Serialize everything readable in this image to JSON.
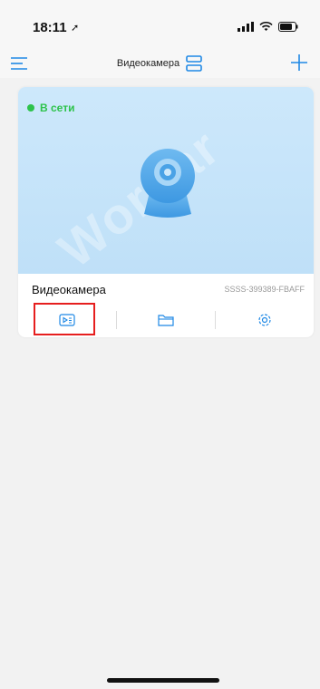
{
  "status_bar": {
    "time": "18:11",
    "icons": [
      "location-arrow-icon",
      "signal-icon",
      "wifi-icon",
      "battery-icon"
    ]
  },
  "header": {
    "title": "Видеокамера",
    "icons": [
      "menu-icon",
      "layout-icon",
      "plus-icon"
    ],
    "accent_color": "#1e88e5"
  },
  "device_card": {
    "status": "В сети",
    "status_color": "#2ec34b",
    "watermark": "Wordar",
    "name": "Видеокамера",
    "id": "SSSS-399389-FBAFF",
    "actions": [
      {
        "icon": "playback-file-icon",
        "highlighted": true
      },
      {
        "icon": "folder-icon"
      },
      {
        "icon": "settings-gear-icon"
      }
    ],
    "highlight_color": "#e61e1e"
  }
}
